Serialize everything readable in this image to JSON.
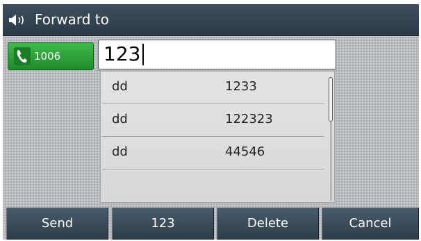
{
  "header": {
    "title": "Forward to",
    "icon": "speaker-volume-icon"
  },
  "line_key": {
    "label": "1006",
    "icon": "phone-handset-icon",
    "color": "#2ea63a"
  },
  "input": {
    "value": "123"
  },
  "suggestions": [
    {
      "name": "dd",
      "number": "1233"
    },
    {
      "name": "dd",
      "number": "122323"
    },
    {
      "name": "dd",
      "number": "44546"
    }
  ],
  "softkeys": [
    {
      "label": "Send"
    },
    {
      "label": "123"
    },
    {
      "label": "Delete"
    },
    {
      "label": "Cancel"
    }
  ]
}
